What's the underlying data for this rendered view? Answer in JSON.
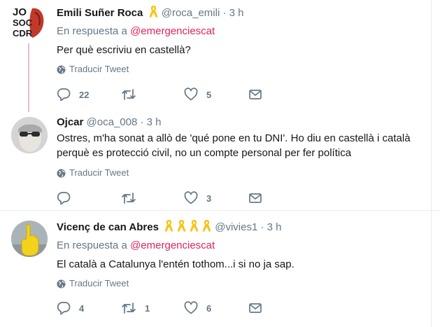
{
  "tweets": [
    {
      "name": "Emili Suñer Roca",
      "handle": "@roca_emili",
      "dot": "·",
      "time": "3 h",
      "reply_prefix": "En respuesta a ",
      "reply_mention": "@emergenciescat",
      "text": "Per què escriviu en castellà?",
      "translate": "Traducir Tweet",
      "replies": "22",
      "retweets": "",
      "likes": "5",
      "avatar_text": [
        "JO",
        "SOC",
        "CDR"
      ]
    },
    {
      "name": "Ojcar",
      "handle": "@oca_008",
      "dot": "·",
      "time": "3 h",
      "text_lines": [
        "Ostres, m'ha sonat a allò de 'qué pone en tu DNI'. Ho diu en castellà i català",
        "perquè es protecció civil, no un compte personal per fer política"
      ],
      "translate": "Traducir Tweet",
      "replies": "",
      "retweets": "",
      "likes": "3"
    },
    {
      "name": "Vicenç de can Abres",
      "handle": "@vivies1",
      "dot": "·",
      "time": "3 h",
      "reply_prefix": "En respuesta a ",
      "reply_mention": "@emergenciescat",
      "text": "El català a Catalunya l'entén tothom...i si no ja sap.",
      "translate": "Traducir Tweet",
      "replies": "4",
      "retweets": "1",
      "likes": "6"
    }
  ],
  "colors": {
    "ribbon": "#f5c518",
    "mention": "#e0245e",
    "muted": "#657786",
    "thread": "#e1bfc9"
  },
  "icons": [
    "reply-icon",
    "retweet-icon",
    "like-icon",
    "message-icon",
    "globe-icon",
    "yellow-ribbon-icon"
  ]
}
